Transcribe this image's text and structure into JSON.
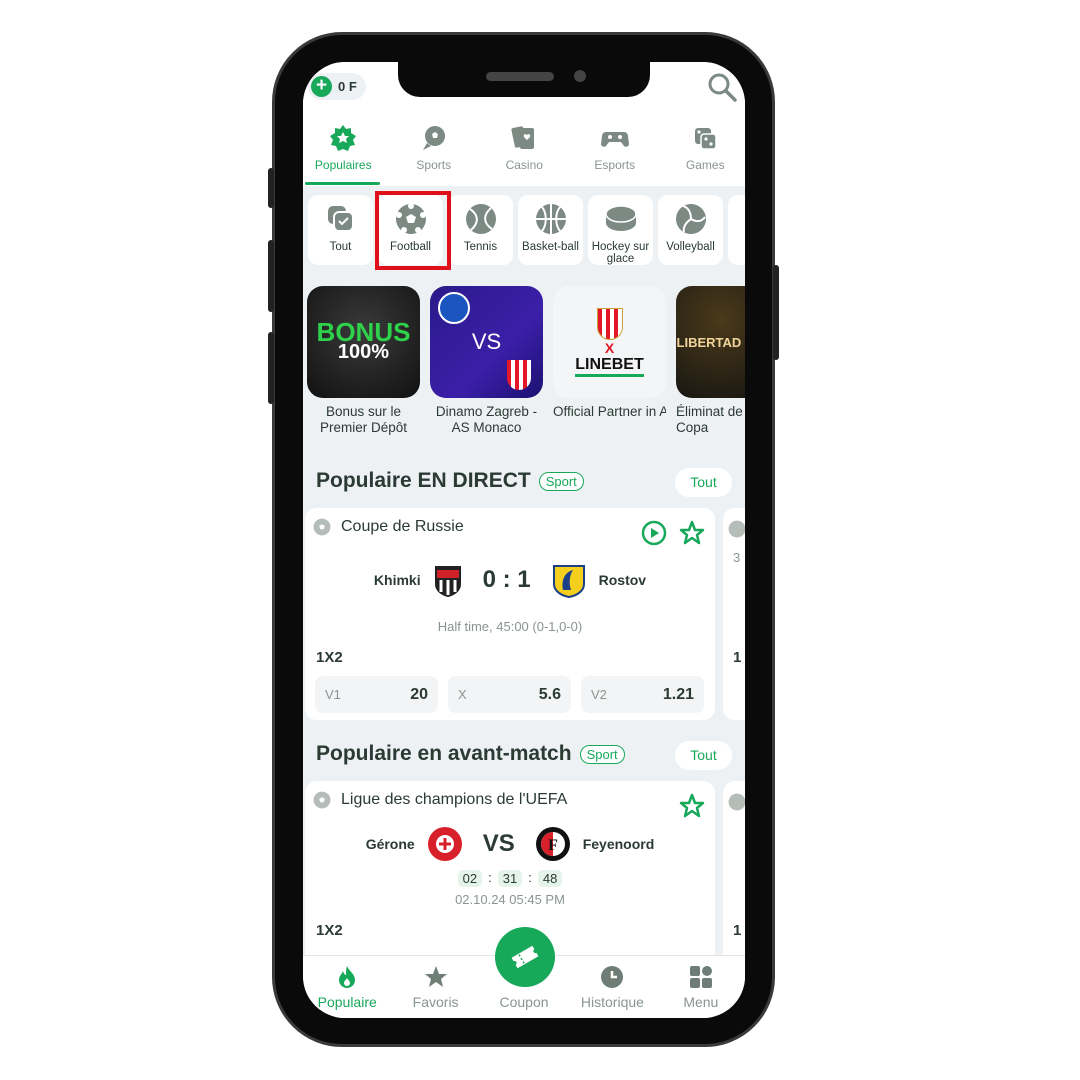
{
  "header": {
    "balance": "0 F"
  },
  "top_tabs": [
    {
      "label": "Populaires",
      "active": true,
      "icon": "badge-star-icon"
    },
    {
      "label": "Sports",
      "icon": "sports-ball-icon"
    },
    {
      "label": "Casino",
      "icon": "cards-icon"
    },
    {
      "label": "Esports",
      "icon": "gamepad-icon"
    },
    {
      "label": "Games",
      "icon": "dice-icon"
    }
  ],
  "sports": [
    {
      "label": "Tout",
      "icon": "all-check-icon"
    },
    {
      "label": "Football",
      "icon": "football-icon",
      "highlighted": true
    },
    {
      "label": "Tennis",
      "icon": "tennis-icon"
    },
    {
      "label": "Basket-ball",
      "icon": "basketball-icon"
    },
    {
      "label": "Hockey sur glace",
      "icon": "hockey-puck-icon"
    },
    {
      "label": "Volleyball",
      "icon": "volleyball-icon"
    }
  ],
  "banners": [
    {
      "caption": "Bonus sur le Premier Dépôt",
      "art": "BONUS 100%"
    },
    {
      "caption": "Dinamo Zagreb - AS Monaco",
      "art": "VS"
    },
    {
      "caption": "Official Partner in Africa and MEN…",
      "art": "LINEBET"
    },
    {
      "caption": "Éliminat de la Copa",
      "art": "LIBERTAD PLAYO"
    }
  ],
  "live": {
    "title": "Populaire EN DIRECT",
    "badge": "Sport",
    "all": "Tout",
    "match": {
      "league": "Coupe de Russie",
      "home": "Khimki",
      "away": "Rostov",
      "score": "0 : 1",
      "status": "Half time, 45:00 (0-1,0-0)",
      "market": "1X2",
      "odds": [
        {
          "label": "V1",
          "value": "20"
        },
        {
          "label": "X",
          "value": "5.6"
        },
        {
          "label": "V2",
          "value": "1.21"
        }
      ]
    },
    "peek": {
      "time": "3",
      "market": "1"
    }
  },
  "prematch": {
    "title": "Populaire en avant-match",
    "badge": "Sport",
    "all": "Tout",
    "match": {
      "league": "Ligue des champions de l'UEFA",
      "home": "Gérone",
      "away": "Feyenoord",
      "vs": "VS",
      "timer": [
        "02",
        "31",
        "48"
      ],
      "date": "02.10.24 05:45 PM",
      "market": "1X2"
    },
    "peek": {
      "market": "1"
    }
  },
  "bottom_nav": [
    {
      "label": "Populaire",
      "active": true
    },
    {
      "label": "Favoris"
    },
    {
      "label": "Coupon"
    },
    {
      "label": "Historique"
    },
    {
      "label": "Menu"
    }
  ],
  "colors": {
    "accent": "#17a85a",
    "highlight": "#e0101a",
    "text": "#2b3a33"
  }
}
